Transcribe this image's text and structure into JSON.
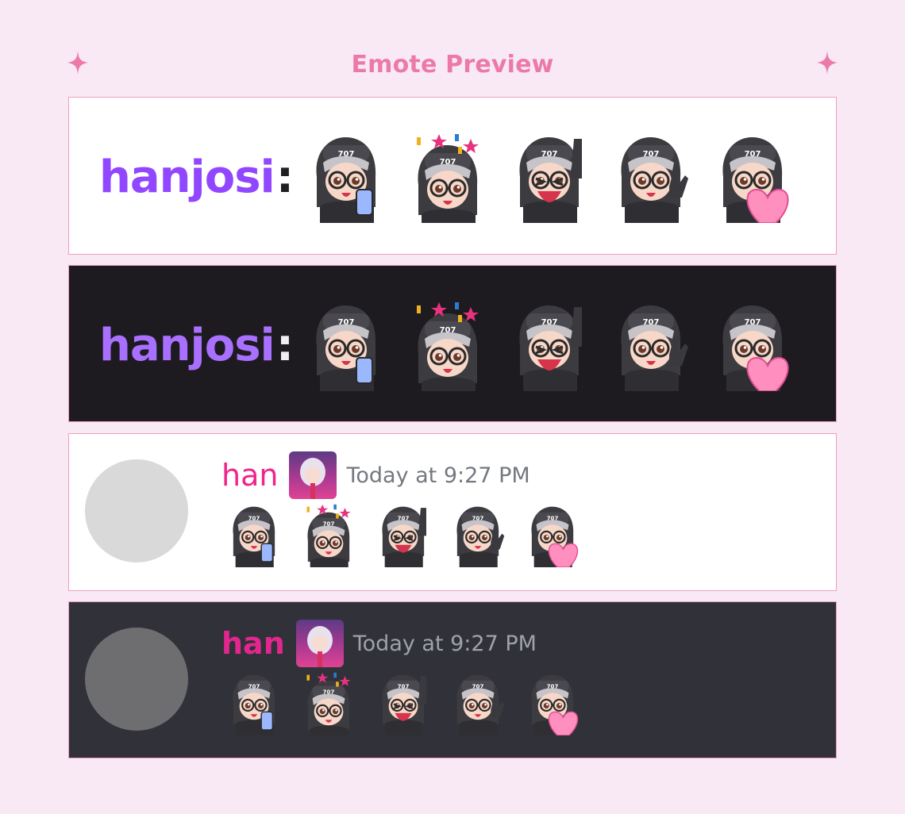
{
  "header": {
    "title": "Emote Preview"
  },
  "colors": {
    "background": "#f9e9f5",
    "accent": "#ec7aa8",
    "twitch_name": "#9146ff",
    "discord_name": "#f0248c",
    "panel_border": "#ef9ec1"
  },
  "twitch_light": {
    "username": "hanjosi",
    "separator": ":"
  },
  "twitch_dark": {
    "username": "hanjosi",
    "separator": ":"
  },
  "discord_light": {
    "username": "han",
    "timestamp": "Today at 9:27 PM"
  },
  "discord_dark": {
    "username": "han",
    "timestamp": "Today at 9:27 PM"
  },
  "emotes": [
    {
      "name": "phone-emote",
      "description": "worried with phone"
    },
    {
      "name": "celebrate-emote",
      "description": "celebrating with confetti"
    },
    {
      "name": "laugh-emote",
      "description": "laughing thumbs up"
    },
    {
      "name": "wave-emote",
      "description": "waving hello"
    },
    {
      "name": "heart-emote",
      "description": "holding a heart"
    }
  ]
}
